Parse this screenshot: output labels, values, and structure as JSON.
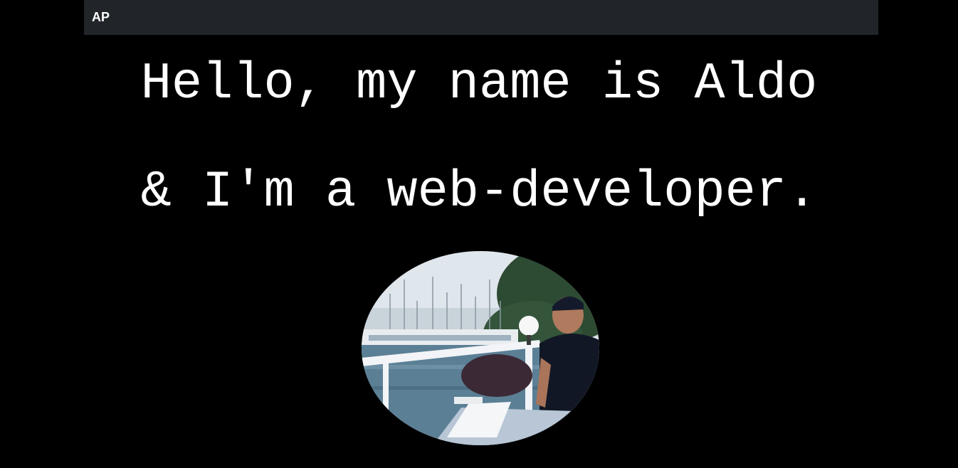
{
  "navbar": {
    "brand": "AP"
  },
  "hero": {
    "line1": "Hello, my name is Aldo",
    "line2": "& I'm a web-developer."
  },
  "portrait": {
    "alt": "Portrait photo at a marina",
    "colors": {
      "sky": "#dfe6ec",
      "water": "#5b7f95",
      "foliage": "#2d4a32",
      "shirt": "#121726",
      "skin": "#b07a5e",
      "railing": "#f2f4f7"
    }
  }
}
